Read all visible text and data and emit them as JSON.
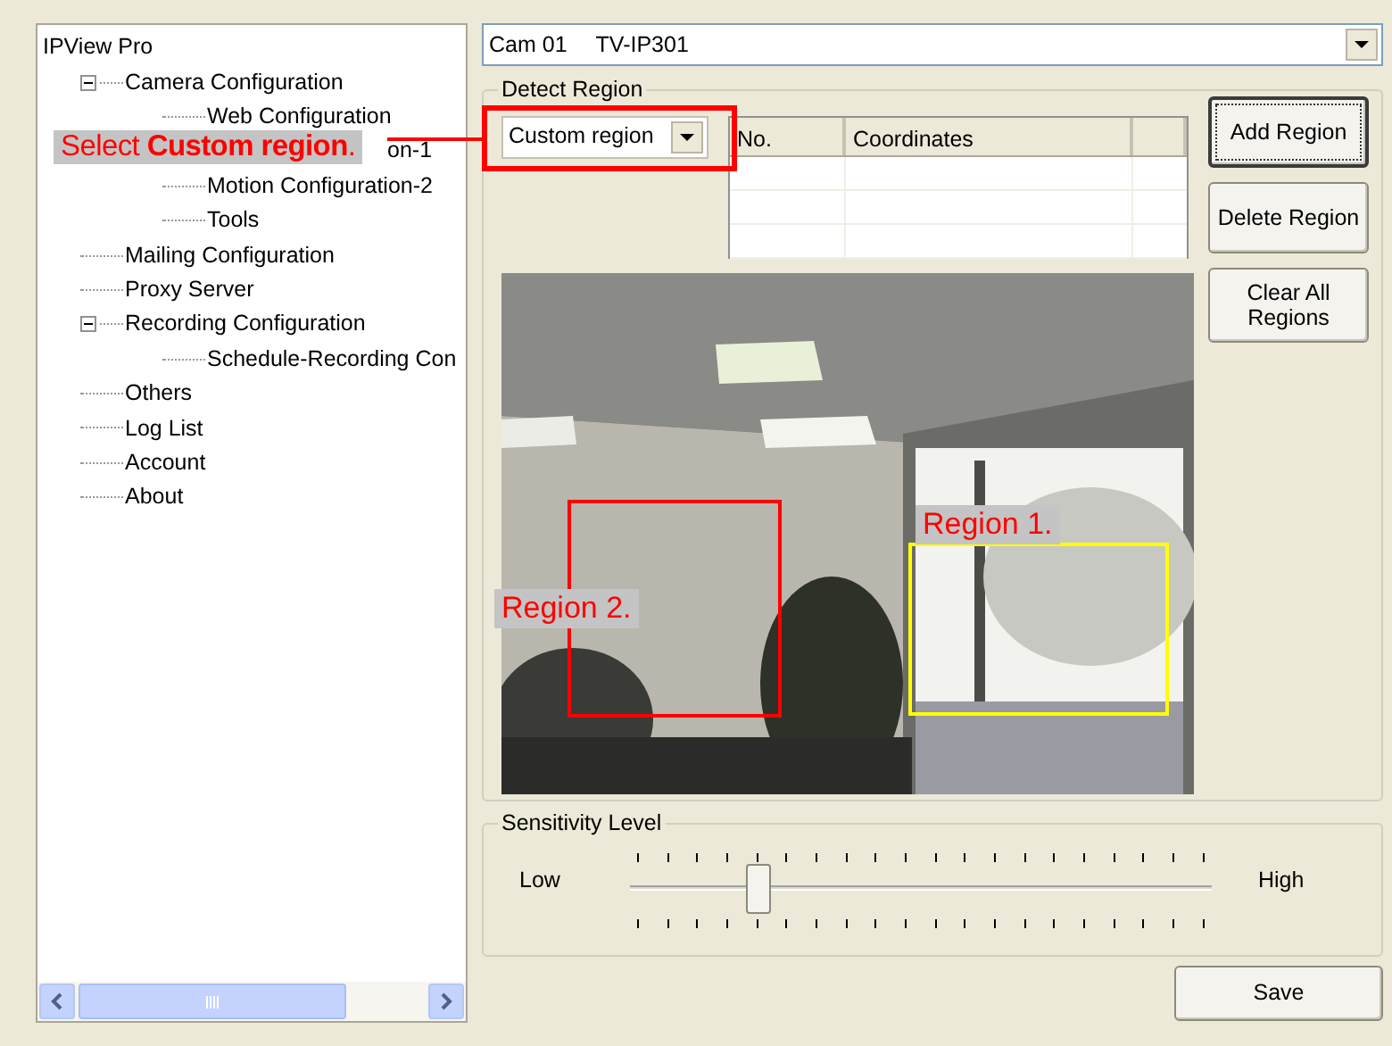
{
  "tree": {
    "label": "IPView Pro",
    "children": [
      {
        "label": "Camera Configuration",
        "expanded": true,
        "children": [
          {
            "label": "Web Configuration"
          },
          {
            "label": "on-1"
          },
          {
            "label": "Motion Configuration-2"
          },
          {
            "label": "Tools"
          }
        ]
      },
      {
        "label": "Mailing Configuration"
      },
      {
        "label": "Proxy Server"
      },
      {
        "label": "Recording Configuration",
        "expanded": true,
        "children": [
          {
            "label": "Schedule-Recording Con"
          }
        ]
      },
      {
        "label": "Others"
      },
      {
        "label": "Log List"
      },
      {
        "label": "Account"
      },
      {
        "label": "About"
      }
    ]
  },
  "callout": {
    "text": "Select **Custom region**."
  },
  "camera_select": {
    "camera": "Cam 01",
    "model": "TV-IP301"
  },
  "detect_region": {
    "legend": "Detect Region",
    "mode": "Custom region",
    "table": {
      "columns": [
        "No.",
        "Coordinates"
      ]
    },
    "buttons": [
      {
        "label": "Add Region",
        "focused": true
      },
      {
        "label": "Delete Region",
        "focused": false
      },
      {
        "label": "Clear All Regions",
        "focused": false
      }
    ],
    "regions": [
      {
        "label": "Region 1.",
        "color": "#ffff00"
      },
      {
        "label": "Region 2.",
        "color": "#ff0000"
      }
    ]
  },
  "sensitivity": {
    "legend": "Sensitivity Level",
    "low": "Low",
    "high": "High",
    "level": 0.22
  },
  "save_button": "Save"
}
